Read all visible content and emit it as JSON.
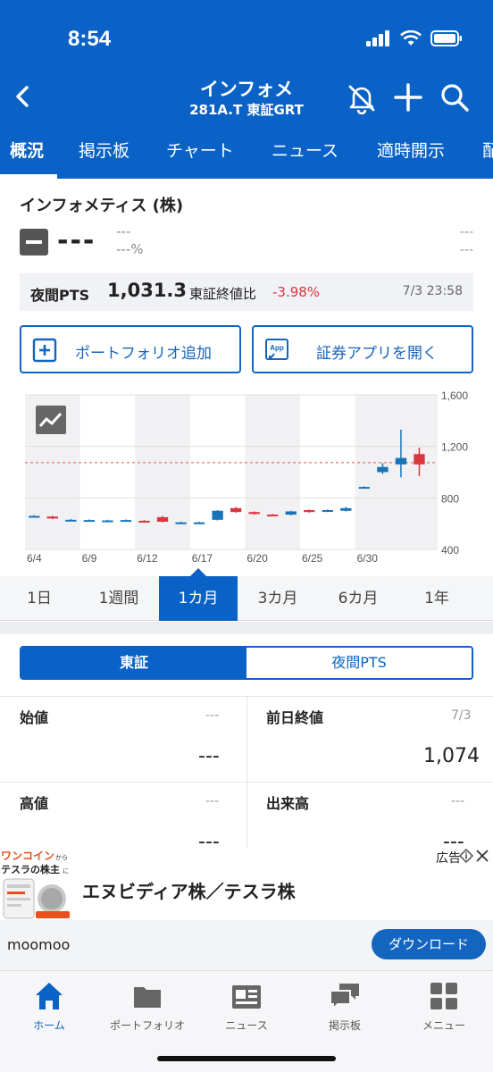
{
  "status": {
    "time": "8:54"
  },
  "nav": {
    "title": "インフォメ",
    "subtitle": "281A.T 東証GRT"
  },
  "tabs": [
    "概況",
    "掲示板",
    "チャート",
    "ニュース",
    "適時開示",
    "配"
  ],
  "stock": {
    "name": "インフォメティス (株)",
    "price": "---",
    "change": "---",
    "change_pct": "---%",
    "right_top": "---",
    "right_bottom": "---"
  },
  "pts": {
    "label": "夜間PTS",
    "price": "1,031.3",
    "compare_label": "東証終値比",
    "compare_pct": "-3.98%",
    "datetime": "7/3 23:58"
  },
  "buttons": {
    "portfolio": "ポートフォリオ追加",
    "app_icon_text": "App",
    "open_app": "証券アプリを開く"
  },
  "chart_data": {
    "type": "candlestick",
    "x_tick_labels": [
      "6/4",
      "6/9",
      "6/12",
      "6/17",
      "6/20",
      "6/25",
      "6/30"
    ],
    "y_tick_labels": [
      "1,600",
      "1,200",
      "800",
      "400"
    ],
    "ylim": [
      400,
      1600
    ],
    "reference_line": 1074,
    "colors": {
      "up": "#d9363e",
      "down": "#1674b8",
      "reference": "#e05555"
    },
    "candles": [
      {
        "open": 660,
        "close": 655,
        "high": 665,
        "low": 650,
        "dir": "down"
      },
      {
        "open": 640,
        "close": 655,
        "high": 660,
        "low": 635,
        "dir": "up"
      },
      {
        "open": 630,
        "close": 625,
        "high": 635,
        "low": 620,
        "dir": "down"
      },
      {
        "open": 625,
        "close": 628,
        "high": 632,
        "low": 620,
        "dir": "down"
      },
      {
        "open": 625,
        "close": 620,
        "high": 630,
        "low": 615,
        "dir": "down"
      },
      {
        "open": 625,
        "close": 628,
        "high": 632,
        "low": 620,
        "dir": "down"
      },
      {
        "open": 620,
        "close": 622,
        "high": 628,
        "low": 615,
        "dir": "up"
      },
      {
        "open": 615,
        "close": 650,
        "high": 660,
        "low": 610,
        "dir": "up"
      },
      {
        "open": 605,
        "close": 610,
        "high": 615,
        "low": 600,
        "dir": "down"
      },
      {
        "open": 610,
        "close": 605,
        "high": 615,
        "low": 600,
        "dir": "down"
      },
      {
        "open": 630,
        "close": 700,
        "high": 705,
        "low": 625,
        "dir": "down"
      },
      {
        "open": 690,
        "close": 720,
        "high": 730,
        "low": 685,
        "dir": "up"
      },
      {
        "open": 690,
        "close": 675,
        "high": 695,
        "low": 670,
        "dir": "up"
      },
      {
        "open": 670,
        "close": 668,
        "high": 675,
        "low": 665,
        "dir": "up"
      },
      {
        "open": 670,
        "close": 695,
        "high": 700,
        "low": 665,
        "dir": "down"
      },
      {
        "open": 690,
        "close": 705,
        "high": 710,
        "low": 685,
        "dir": "up"
      },
      {
        "open": 695,
        "close": 705,
        "high": 710,
        "low": 690,
        "dir": "down"
      },
      {
        "open": 700,
        "close": 720,
        "high": 730,
        "low": 695,
        "dir": "down"
      },
      {
        "open": 880,
        "close": 885,
        "high": 890,
        "low": 875,
        "dir": "down"
      },
      {
        "open": 1000,
        "close": 1040,
        "high": 1070,
        "low": 985,
        "dir": "down"
      },
      {
        "open": 1060,
        "close": 1110,
        "high": 1330,
        "low": 960,
        "dir": "down"
      },
      {
        "open": 1140,
        "close": 1060,
        "high": 1190,
        "low": 970,
        "dir": "up"
      }
    ]
  },
  "ranges": [
    "1日",
    "1週間",
    "1カ月",
    "3カ月",
    "6カ月",
    "1年"
  ],
  "market_segment": {
    "active": "東証",
    "inactive": "夜間PTS"
  },
  "quote": {
    "open_label": "始値",
    "open_meta": "---",
    "open_value": "---",
    "prev_close_label": "前日終値",
    "prev_close_meta": "7/3",
    "prev_close_value": "1,074",
    "high_label": "高値",
    "high_meta": "---",
    "high_value": "---",
    "volume_label": "出来高",
    "volume_meta": "---",
    "volume_value": "---"
  },
  "ad": {
    "image_line1a": "ワンコイン",
    "image_line1b": "から",
    "image_line2a": "テスラの株主",
    "image_line2b": "に",
    "title": "エヌビディア株／テスラ株",
    "label": "広告",
    "brand": "moomoo",
    "cta": "ダウンロード"
  },
  "tabbar": [
    {
      "label": "ホーム",
      "icon": "home-icon"
    },
    {
      "label": "ポートフォリオ",
      "icon": "folder-icon"
    },
    {
      "label": "ニュース",
      "icon": "newspaper-icon"
    },
    {
      "label": "掲示板",
      "icon": "chat-icon"
    },
    {
      "label": "メニュー",
      "icon": "grid-icon"
    }
  ]
}
